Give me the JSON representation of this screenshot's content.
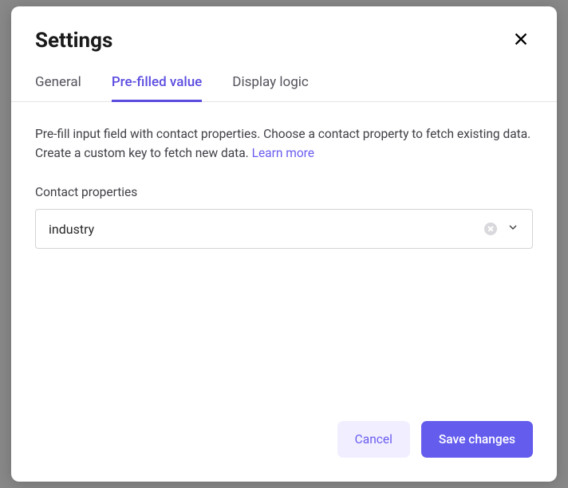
{
  "modal": {
    "title": "Settings"
  },
  "tabs": {
    "general": "General",
    "prefilled": "Pre-filled value",
    "display_logic": "Display logic"
  },
  "content": {
    "description_part1": "Pre-fill input field with contact properties. Choose a contact property to fetch existing data. Create a custom key to fetch new data. ",
    "learn_more": "Learn more",
    "field_label": "Contact properties",
    "select_value": "industry"
  },
  "footer": {
    "cancel": "Cancel",
    "save": "Save changes"
  }
}
